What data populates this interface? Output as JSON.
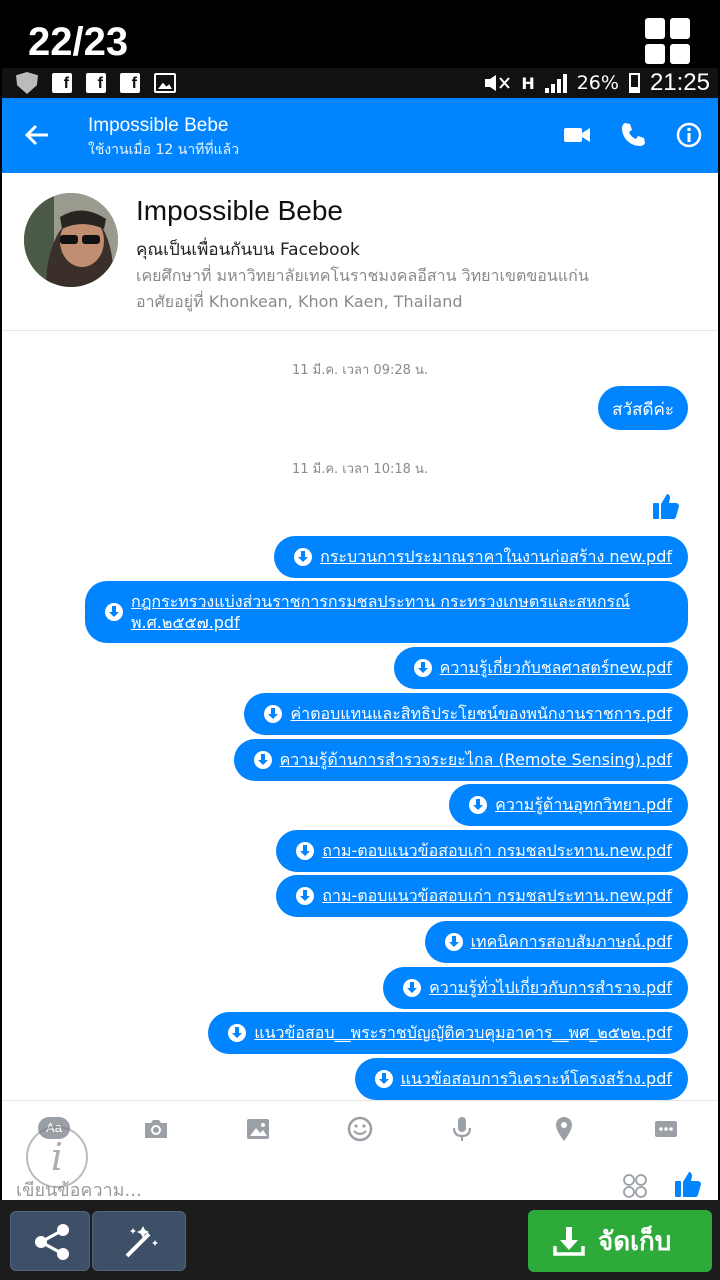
{
  "viewer": {
    "counter": "22/23",
    "save_label": "จัดเก็บ",
    "icons": [
      "grid-icon",
      "share-icon",
      "magic-wand-icon",
      "download-icon"
    ]
  },
  "statusbar": {
    "network": "H",
    "battery": "26%",
    "time": "21:25",
    "icons": [
      "shield-icon",
      "facebook-icon",
      "facebook-icon",
      "facebook-icon",
      "image-icon",
      "mute-icon",
      "signal-icon",
      "battery-icon"
    ]
  },
  "header": {
    "name": "Impossible Bebe",
    "status": "ใช้งานเมื่อ 12 นาทีที่แล้ว",
    "color": "#0084ff",
    "icons": [
      "back-arrow-icon",
      "video-call-icon",
      "phone-icon",
      "info-icon"
    ]
  },
  "profile": {
    "name": "Impossible Bebe",
    "friend_note": "คุณเป็นเพื่อนกันบน Facebook",
    "education": "เคยศึกษาที่ มหาวิทยาลัยเทคโนราชมงคลอีสาน วิทยาเขตขอนแก่น",
    "location": "อาศัยอยู่ที่ Khonkean, Khon Kaen, Thailand"
  },
  "messages": {
    "timestamp1": "11 มี.ค. เวลา 09:28 น.",
    "greeting": "สวัสดีค่ะ",
    "timestamp2": "11 มี.ค. เวลา 10:18 น.",
    "files": [
      "กระบวนการประมาณราคาในงานก่อสร้าง new.pdf",
      "กฎกระทรวงแบ่งส่วนราชการกรมชลประทาน กระทรวงเกษตรและสหกรณ์ พ.ศ.๒๕๕๗.pdf",
      "ความรู้เกี่ยวกับชลศาสตร์new.pdf",
      "ค่าตอบแทนและสิทธิประโยชน์ของพนักงานราชการ.pdf",
      "ความรู้ด้านการสำรวจระยะไกล (Remote Sensing).pdf",
      "ความรู้ด้านอุทกวิทยา.pdf",
      "ถาม-ตอบแนวข้อสอบเก่า กรมชลประทาน.new.pdf",
      "ถาม-ตอบแนวข้อสอบเก่า กรมชลประทาน.new.pdf",
      "เทคนิคการสอบสัมภาษณ์.pdf",
      "ความรู้ทั่วไปเกี่ยวกับการสำรวจ.pdf",
      "แนวข้อสอบ__พระราชบัญญัติควบคุมอาคาร__พศ_๒๕๒๒.pdf",
      "แนวข้อสอบการวิเคราะห์โครงสร้าง.pdf"
    ]
  },
  "composer": {
    "aa_label": "Aa",
    "placeholder": "เขียนข้อความ...",
    "watermark": "i",
    "icons": [
      "camera-icon",
      "gallery-icon",
      "emoji-icon",
      "microphone-icon",
      "location-pin-icon",
      "more-icon",
      "sticker-icon",
      "like-icon"
    ]
  }
}
